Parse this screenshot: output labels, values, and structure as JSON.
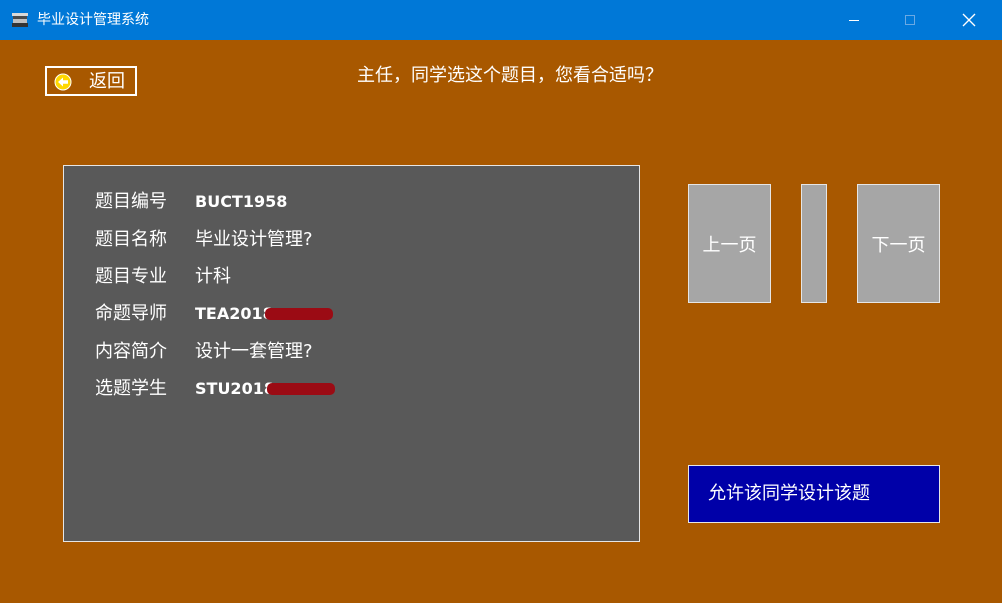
{
  "window": {
    "title": "毕业设计管理系统"
  },
  "toolbar": {
    "back_label": "返回"
  },
  "prompt": "主任，同学选这个题目，您看合适吗？",
  "topic_info": {
    "rows": [
      {
        "label": "题目编号",
        "value": "BUCT1958"
      },
      {
        "label": "题目名称",
        "value": "毕业设计管理?"
      },
      {
        "label": "题目专业",
        "value": "计科"
      },
      {
        "label": "命题导师",
        "value": "TEA2018"
      },
      {
        "label": "内容简介",
        "value": "设计一套管理?"
      },
      {
        "label": "选题学生",
        "value": "STU2018"
      }
    ]
  },
  "pagination": {
    "prev_label": "上一页",
    "next_label": "下一页"
  },
  "actions": {
    "approve_label": "允许该同学设计该题"
  },
  "colors": {
    "titlebar": "#0078d7",
    "background": "#a85800",
    "panel": "#595959",
    "nav_button": "#a6a6a6",
    "approve_button": "#0000a8",
    "redaction": "#9b0b14"
  }
}
